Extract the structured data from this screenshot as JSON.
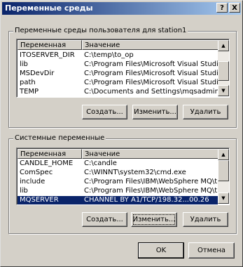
{
  "window": {
    "title": "Переменные среды",
    "help_label": "?",
    "close_label": "X"
  },
  "user_vars": {
    "group_label": "Переменные среды пользователя для station1",
    "columns": [
      "Переменная",
      "Значение"
    ],
    "rows": [
      {
        "name": "ITOSERVER_DIR",
        "value": "C:\\temp\\to_op"
      },
      {
        "name": "lib",
        "value": "C:\\Program Files\\Microsoft Visual Studio ..."
      },
      {
        "name": "MSDevDir",
        "value": "C:\\Program Files\\Microsoft Visual Studio ..."
      },
      {
        "name": "path",
        "value": "C:\\Program Files\\Microsoft Visual Studio ..."
      },
      {
        "name": "TEMP",
        "value": "C:\\Documents and Settings\\mqsadmin\\Lo..."
      }
    ],
    "buttons": {
      "new": "Создать...",
      "edit": "Изменить...",
      "delete": "Удалить"
    }
  },
  "system_vars": {
    "group_label": "Системные переменные",
    "columns": [
      "Переменная",
      "Значение"
    ],
    "rows": [
      {
        "name": "CANDLE_HOME",
        "value": "C:\\candle"
      },
      {
        "name": "ComSpec",
        "value": "C:\\WINNT\\system32\\cmd.exe"
      },
      {
        "name": "include",
        "value": "C:\\Program Files\\IBM\\WebSphere MQ\\t..."
      },
      {
        "name": "lib",
        "value": "C:\\Program Files\\IBM\\WebSphere MQ\\t..."
      },
      {
        "name": "MQSERVER",
        "value": "CHANNEL BY A1/TCP/198.32...00.26"
      }
    ],
    "selected_index": 4,
    "buttons": {
      "new": "Создать...",
      "edit": "Изменить...",
      "delete": "Удалить"
    }
  },
  "footer": {
    "ok": "OK",
    "cancel": "Отмена"
  }
}
